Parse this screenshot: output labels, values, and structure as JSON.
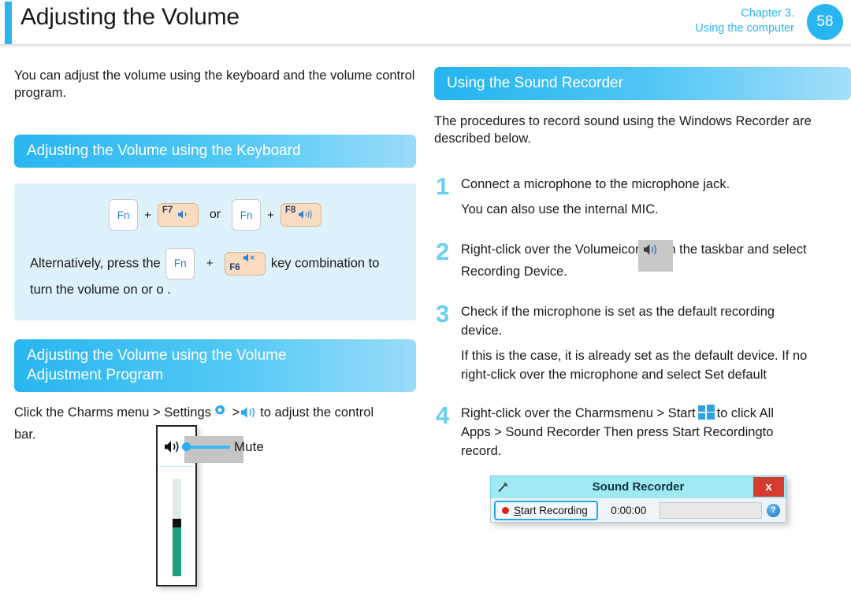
{
  "header": {
    "title": "Adjusting the Volume",
    "chapter_line1": "Chapter 3.",
    "chapter_line2": "Using the computer",
    "page_number": "58",
    "accent_color": "#29b6f0"
  },
  "left_column": {
    "intro": "You can adjust the volume using the keyboard and the volume control program.",
    "section1_title": "Adjusting the Volume using the Keyboard",
    "keys": {
      "fn_label": "Fn",
      "plus": "+",
      "or": "or",
      "f7_label": "F7",
      "f7_icon": "speaker-down-icon",
      "f8_label": "F8",
      "f8_icon": "speaker-up-icon",
      "f6_label": "F6",
      "f6_icon": "speaker-mute-icon"
    },
    "alt_text_before": "Alternatively, press the",
    "alt_text_middle": "key combination to",
    "alt_text_after": "turn the volume on or o .",
    "section2_title_line1": "Adjusting the Volume using the Volume",
    "section2_title_line2": "Adjustment Program",
    "charms_before": "Click the Charms menu > Settings",
    "charms_gt1": ">",
    "charms_after": "to adjust the control",
    "charms_line2": "bar.",
    "gear_icon": "gear-icon",
    "speaker_icon": "speaker-icon",
    "volume_widget": {
      "speaker_icon": "speaker-icon",
      "mute_label": "Mute"
    }
  },
  "right_column": {
    "section_title": "Using the Sound Recorder",
    "intro": "The procedures to record sound using the Windows Recorder are",
    "intro_line2": "described below.",
    "steps": [
      {
        "number": "1",
        "lines": [
          "Connect a microphone to the microphone jack."
        ],
        "sub_lines": [
          "You can also use the internal MIC."
        ]
      },
      {
        "number": "2",
        "line_a": "Right-click over the Volume",
        "line_a2": "icon",
        "line_b": "on the taskbar and select",
        "line_c": "Recording Device.",
        "icon": "volume-icon-highlighted"
      },
      {
        "number": "3",
        "lines": [
          "Check if the microphone is set as the default recording",
          "device."
        ],
        "sub_lines": [
          "If this is the case, it is already set as the default device. If no",
          "right-click over the microphone and select Set default"
        ]
      },
      {
        "number": "4",
        "line_a": "Right-click over the Charms",
        "line_a2": "menu > Start",
        "line_b": "to click All",
        "line_c": "Apps > Sound Recorder Then press Start Recording",
        "line_c2": "to",
        "line_d": "record.",
        "icon": "windows-start-icon"
      }
    ],
    "recorder_dialog": {
      "mic_icon": "microphone-icon",
      "title": "Sound Recorder",
      "close_label": "x",
      "start_button_first": "S",
      "start_button_rest": "tart Recording",
      "timer": "0:00:00",
      "help_label": "?",
      "record_dot": "record-dot-icon"
    }
  }
}
